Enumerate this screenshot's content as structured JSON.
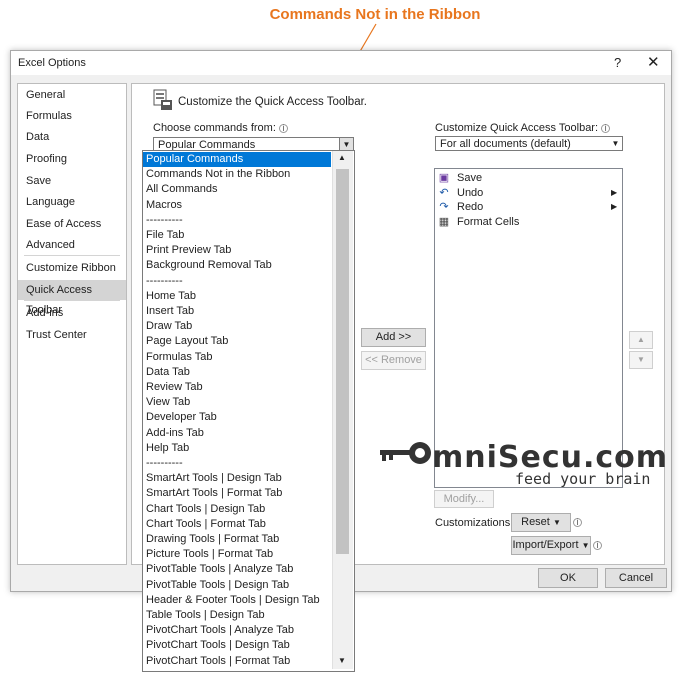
{
  "annotation": "Commands Not in the Ribbon",
  "dialog": {
    "title": "Excel Options",
    "help": "?",
    "close": "✕"
  },
  "nav": {
    "group1": [
      "General",
      "Formulas",
      "Data",
      "Proofing",
      "Save",
      "Language",
      "Ease of Access",
      "Advanced"
    ],
    "group2": [
      "Customize Ribbon",
      "Quick Access Toolbar"
    ],
    "group3": [
      "Add-ins",
      "Trust Center"
    ],
    "selected": "Quick Access Toolbar"
  },
  "header": {
    "title": "Customize the Quick Access Toolbar."
  },
  "left": {
    "label": "Choose commands from:",
    "selected": "Popular Commands"
  },
  "right": {
    "label": "Customize Quick Access Toolbar:",
    "selected": "For all documents (default)"
  },
  "dropdown": {
    "items": [
      "Popular Commands",
      "Commands Not in the Ribbon",
      "All Commands",
      "Macros",
      "----------",
      "File Tab",
      "Print Preview Tab",
      "Background Removal Tab",
      "----------",
      "Home Tab",
      "Insert Tab",
      "Draw Tab",
      "Page Layout Tab",
      "Formulas Tab",
      "Data Tab",
      "Review Tab",
      "View Tab",
      "Developer Tab",
      "Add-ins Tab",
      "Help Tab",
      "----------",
      "SmartArt Tools | Design Tab",
      "SmartArt Tools | Format Tab",
      "Chart Tools | Design Tab",
      "Chart Tools | Format Tab",
      "Drawing Tools | Format Tab",
      "Picture Tools | Format Tab",
      "PivotTable Tools | Analyze Tab",
      "PivotTable Tools | Design Tab",
      "Header & Footer Tools | Design Tab",
      "Table Tools | Design Tab",
      "PivotChart Tools | Analyze Tab",
      "PivotChart Tools | Design Tab",
      "PivotChart Tools | Format Tab"
    ]
  },
  "qat": {
    "items": [
      {
        "label": "Save",
        "icon": "save-icon",
        "glyph": "💾"
      },
      {
        "label": "Undo",
        "icon": "undo-icon",
        "glyph": "↶"
      },
      {
        "label": "Redo",
        "icon": "redo-icon",
        "glyph": "↷"
      },
      {
        "label": "Format Cells",
        "icon": "format-cells-icon",
        "glyph": "▦"
      }
    ]
  },
  "buttons": {
    "add": "Add >>",
    "remove": "<< Remove",
    "modify": "Modify...",
    "reset": "Reset",
    "import_export": "Import/Export",
    "ok": "OK",
    "cancel": "Cancel",
    "up": "▲",
    "down": "▼"
  },
  "customizations_label": "Customizations:",
  "logo": {
    "brand": "mniSecu.com",
    "tagline": "feed your brain"
  },
  "colors": {
    "accent": "#e8761e",
    "selection": "#0078d7"
  }
}
